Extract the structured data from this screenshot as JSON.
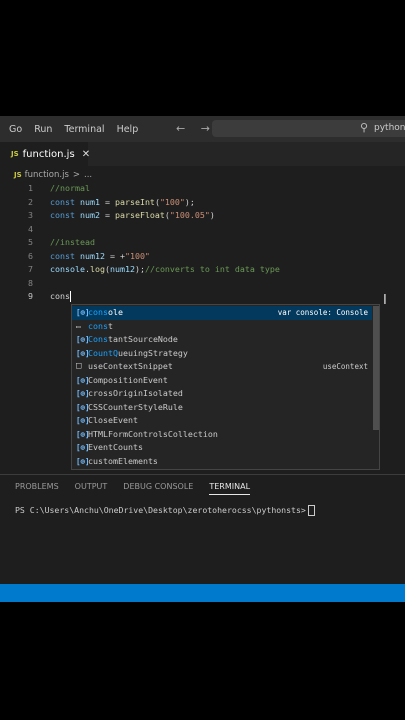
{
  "menu": [
    "Go",
    "Run",
    "Terminal",
    "Help"
  ],
  "nav_arrows": "← →",
  "search": {
    "text": "pythons"
  },
  "tab": {
    "icon": "JS",
    "label": "function.js",
    "close": "✕"
  },
  "breadcrumb": {
    "icon": "JS",
    "file": "function.js",
    "sep": ">",
    "rest": "..."
  },
  "code": [
    {
      "n": "1",
      "parts": [
        {
          "c": "cmt",
          "t": "//normal"
        }
      ]
    },
    {
      "n": "2",
      "parts": [
        {
          "c": "kw",
          "t": "const "
        },
        {
          "c": "var",
          "t": "num1"
        },
        {
          "c": "plain",
          "t": " = "
        },
        {
          "c": "fn",
          "t": "parseInt"
        },
        {
          "c": "plain",
          "t": "("
        },
        {
          "c": "str",
          "t": "\"100\""
        },
        {
          "c": "plain",
          "t": ");"
        }
      ]
    },
    {
      "n": "3",
      "parts": [
        {
          "c": "kw",
          "t": "const "
        },
        {
          "c": "var",
          "t": "num2"
        },
        {
          "c": "plain",
          "t": " = "
        },
        {
          "c": "fn",
          "t": "parseFloat"
        },
        {
          "c": "plain",
          "t": "("
        },
        {
          "c": "str",
          "t": "\"100.05\""
        },
        {
          "c": "plain",
          "t": ")"
        }
      ]
    },
    {
      "n": "4",
      "parts": []
    },
    {
      "n": "5",
      "parts": [
        {
          "c": "cmt",
          "t": "//instead"
        }
      ]
    },
    {
      "n": "6",
      "parts": [
        {
          "c": "kw",
          "t": "const "
        },
        {
          "c": "var",
          "t": "num12"
        },
        {
          "c": "plain",
          "t": " = +"
        },
        {
          "c": "str",
          "t": "\"100\""
        }
      ]
    },
    {
      "n": "7",
      "parts": [
        {
          "c": "var",
          "t": "console"
        },
        {
          "c": "plain",
          "t": "."
        },
        {
          "c": "fn",
          "t": "log"
        },
        {
          "c": "plain",
          "t": "("
        },
        {
          "c": "var",
          "t": "num12"
        },
        {
          "c": "plain",
          "t": ");"
        },
        {
          "c": "cmt",
          "t": "//converts to int data type"
        }
      ]
    },
    {
      "n": "8",
      "parts": []
    },
    {
      "n": "9",
      "parts": [
        {
          "c": "plain",
          "t": "cons"
        }
      ],
      "active": true
    }
  ],
  "suggestions": [
    {
      "icon": "[⊚]",
      "kind": "var",
      "prefix": "cons",
      "rest": "ole",
      "detail": "var console: Console",
      "selected": true
    },
    {
      "icon": "▭",
      "kind": "kw",
      "prefix": "cons",
      "rest": "t",
      "detail": ""
    },
    {
      "icon": "[⊚]",
      "kind": "var",
      "prefix": "Cons",
      "rest": "tantSourceNode",
      "detail": ""
    },
    {
      "icon": "[⊚]",
      "kind": "var",
      "prefix": "CountQ",
      "rest": "ueuingStrategy",
      "detail": ""
    },
    {
      "icon": "□",
      "kind": "snip",
      "prefix": "",
      "rest": "useContextSnippet",
      "detail": "useContext"
    },
    {
      "icon": "[⊚]",
      "kind": "var",
      "prefix": "",
      "rest": "CompositionEvent",
      "detail": ""
    },
    {
      "icon": "[⊚]",
      "kind": "var",
      "prefix": "",
      "rest": "crossOriginIsolated",
      "detail": ""
    },
    {
      "icon": "[⊚]",
      "kind": "var",
      "prefix": "",
      "rest": "CSSCounterStyleRule",
      "detail": ""
    },
    {
      "icon": "[⊚]",
      "kind": "var",
      "prefix": "",
      "rest": "CloseEvent",
      "detail": ""
    },
    {
      "icon": "[⊚]",
      "kind": "var",
      "prefix": "",
      "rest": "HTMLFormControlsCollection",
      "detail": ""
    },
    {
      "icon": "[⊚]",
      "kind": "var",
      "prefix": "",
      "rest": "EventCounts",
      "detail": ""
    },
    {
      "icon": "[⊚]",
      "kind": "var",
      "prefix": "",
      "rest": "customElements",
      "detail": ""
    }
  ],
  "panel": {
    "tabs": [
      "PROBLEMS",
      "OUTPUT",
      "DEBUG CONSOLE",
      "TERMINAL"
    ],
    "active_tab": "TERMINAL",
    "terminal_prompt": "PS C:\\Users\\Anchu\\OneDrive\\Desktop\\zerotoherocss\\pythonsts>"
  },
  "colors": {
    "statusbar": "#007acc",
    "editor_bg": "#1e1e1e",
    "selection": "#04395e"
  }
}
